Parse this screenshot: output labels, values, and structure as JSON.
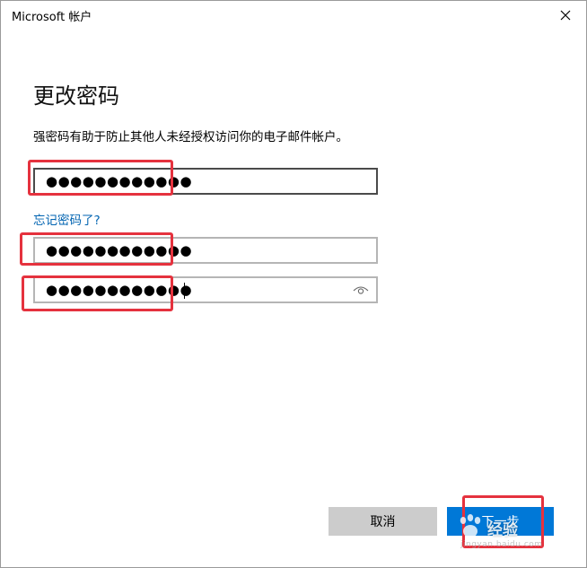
{
  "window": {
    "title": "Microsoft 帐户",
    "close_icon": "close-icon"
  },
  "main": {
    "heading": "更改密码",
    "description": "强密码有助于防止其他人未经授权访问你的电子邮件帐户。",
    "current_password": {
      "value": "●●●●●●●●●●●●"
    },
    "forgot_link": "忘记密码了?",
    "new_password": {
      "value": "●●●●●●●●●●●●"
    },
    "confirm_password": {
      "value": "●●●●●●●●●●●●",
      "reveal_icon": "eye-icon"
    }
  },
  "footer": {
    "cancel_label": "取消",
    "next_label": "下一步"
  },
  "annotations": {
    "highlight_color": "#e5323e"
  },
  "watermark": {
    "brand": "经验",
    "url": "jingyan.baidu.com"
  },
  "colors": {
    "accent": "#0078d7",
    "link": "#0063b1",
    "cancel_bg": "#cccccc"
  }
}
